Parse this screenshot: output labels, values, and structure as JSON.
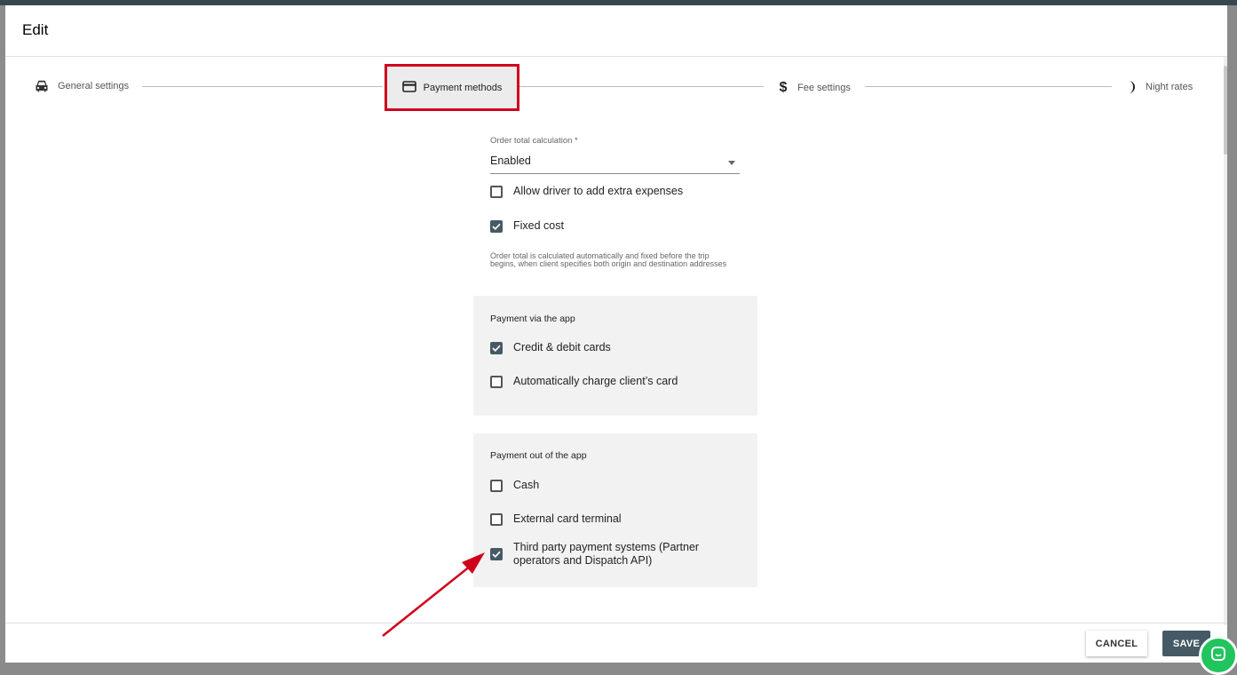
{
  "modal": {
    "title": "Edit"
  },
  "stepper": {
    "steps": [
      {
        "label": "General settings",
        "icon": "car-icon"
      },
      {
        "label": "Payment methods",
        "icon": "credit-card-icon"
      },
      {
        "label": "Fee settings",
        "icon": "dollar-icon"
      },
      {
        "label": "Night rates",
        "icon": "moon-icon"
      }
    ],
    "active_index": 1
  },
  "form": {
    "order_total": {
      "label": "Order total calculation *",
      "value": "Enabled"
    },
    "allow_extra_expenses": {
      "label": "Allow driver to add extra expenses",
      "checked": false
    },
    "fixed_cost": {
      "label": "Fixed cost",
      "checked": true
    },
    "fixed_cost_hint": "Order total is calculated automatically and fixed before the trip begins, when client specifies both origin and destination addresses"
  },
  "payment_via_app": {
    "title": "Payment via the app",
    "options": [
      {
        "label": "Credit & debit cards",
        "checked": true
      },
      {
        "label": "Automatically charge client’s card",
        "checked": false
      }
    ]
  },
  "payment_out_of_app": {
    "title": "Payment out of the app",
    "options": [
      {
        "label": "Cash",
        "checked": false
      },
      {
        "label": "External card terminal",
        "checked": false
      },
      {
        "label": "Third party payment systems (Partner operators and Dispatch API)",
        "checked": true
      }
    ]
  },
  "footer": {
    "cancel_label": "CANCEL",
    "save_label": "SAVE"
  },
  "colors": {
    "accent": "#455a64",
    "highlight": "#d0021b",
    "chat": "#21c45d"
  }
}
